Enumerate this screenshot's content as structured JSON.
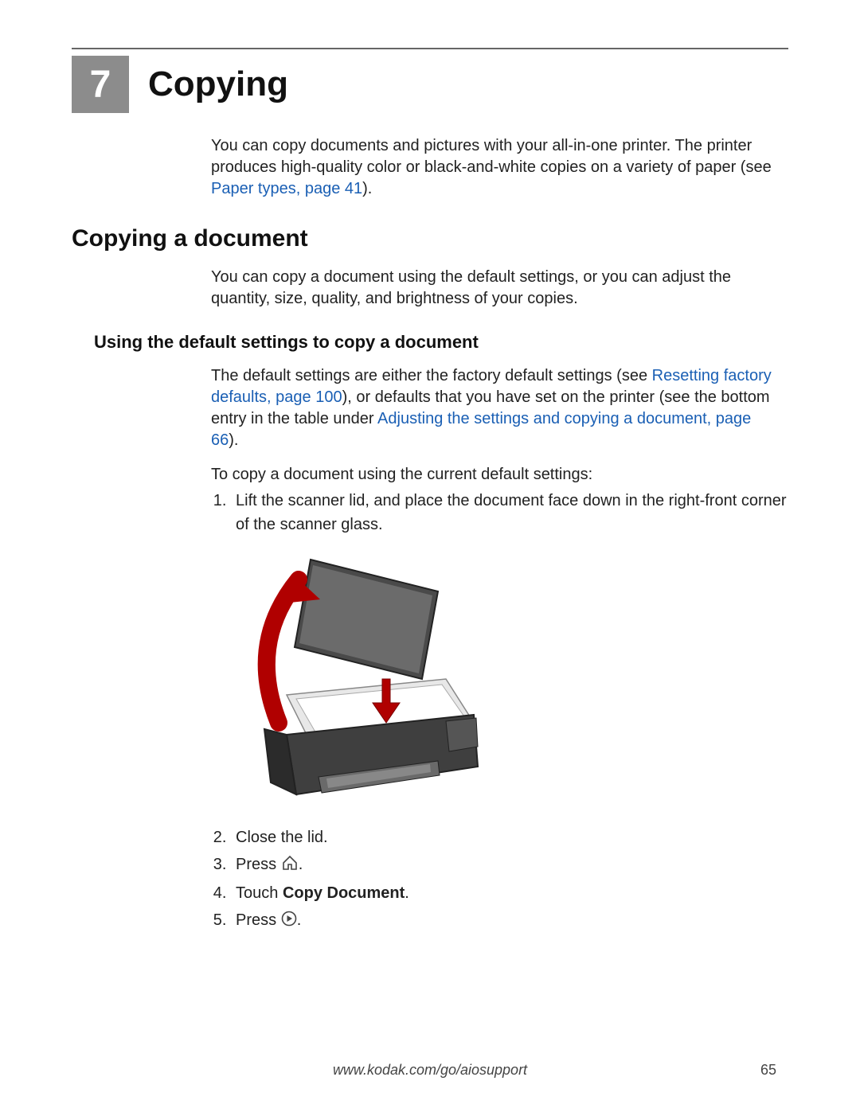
{
  "chapter": {
    "number": "7",
    "title": "Copying"
  },
  "intro": {
    "text": "You can copy documents and pictures with your all-in-one printer. The printer produces high-quality color or black-and-white copies on a variety of paper (see ",
    "link": "Paper types, page 41",
    "close": ")."
  },
  "section1": {
    "title": "Copying a document",
    "para": "You can copy a document using the default settings, or you can adjust the quantity, size, quality, and brightness of your copies."
  },
  "subsection1": {
    "title": "Using the default settings to copy a document",
    "para_a": "The default settings are either the factory default settings (see ",
    "link_a": "Resetting factory defaults, page 100",
    "para_b": "), or defaults that you have set on the printer (see the bottom entry in the table under ",
    "link_b": "Adjusting the settings and copying a document, page 66",
    "para_c": ").",
    "lead": "To copy a document using the current default settings:"
  },
  "steps": {
    "s1": "Lift the scanner lid, and place the document face down in the right-front corner of the scanner glass.",
    "s2": "Close the lid.",
    "s3_prefix": "Press",
    "s3_suffix": ".",
    "s4_prefix": "Touch ",
    "s4_bold": "Copy Document",
    "s4_suffix": ".",
    "s5_prefix": "Press",
    "s5_suffix": "."
  },
  "icons": {
    "home": "home-icon",
    "play": "play-icon"
  },
  "footer": {
    "url": "www.kodak.com/go/aiosupport",
    "page": "65"
  }
}
